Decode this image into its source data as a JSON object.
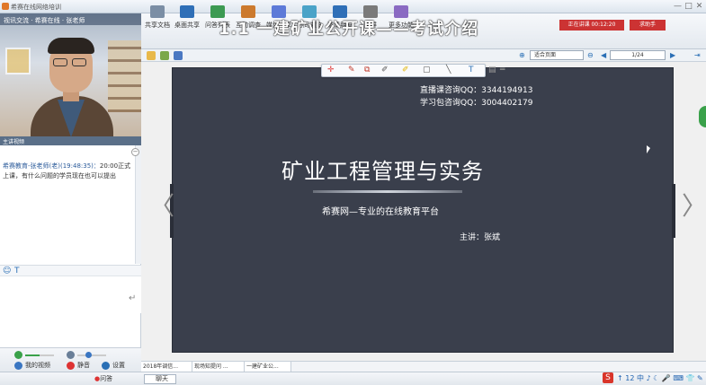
{
  "window": {
    "title": "希赛在线网络培训",
    "controls": [
      "—",
      "□",
      "✕"
    ]
  },
  "left_panel": {
    "video_caption": "视讯交流 · 希赛在线 · 张老师",
    "video_bar_label": "主讲视频",
    "chat": {
      "sender": "希赛教育-张老师(老)(19:48:35)：",
      "message": "20:00正式上课，有什么问题的学员现在也可以提出"
    },
    "chat_tools": [
      "☺",
      "T"
    ],
    "media": {
      "mic_label": "我的视频",
      "mute_label": "静音",
      "settings_label": "设置"
    }
  },
  "toolbar": {
    "items": [
      {
        "label": "共享文档",
        "color": "#7b8ea5"
      },
      {
        "label": "桌面共享",
        "color": "#2f6fb7"
      },
      {
        "label": "问答列表",
        "color": "#3c9a52"
      },
      {
        "label": "互动调查",
        "color": "#cc7a2e"
      },
      {
        "label": "媒体共享",
        "color": "#5d7ad8"
      },
      {
        "label": "协同浏览",
        "color": "#4aa3c8"
      },
      {
        "label": "邀请朋友",
        "color": "#2f6fb7"
      },
      {
        "label": "录屏",
        "color": "#7a7a7a"
      },
      {
        "label": "更多功能",
        "color": "#8a6ac2"
      }
    ],
    "course_title": "1.1 一建矿业公开课——考试介绍",
    "live_badge": "正在讲课 00:12:20",
    "exit_badge": "求助手"
  },
  "navbar": {
    "fit_mode": "适合页面",
    "page": "1/24"
  },
  "slide": {
    "contact1": "直播课咨询QQ：3344194913",
    "contact2": "学习包咨询QQ：3004402179",
    "title": "矿业工程管理与实务",
    "subtitle": "希赛网—专业的在线教育平台",
    "presenter": "主讲：张斌"
  },
  "annotation_tools": [
    {
      "glyph": "✛",
      "name": "pointer-icon",
      "color": "#d33"
    },
    {
      "glyph": "✎",
      "name": "eraser-icon",
      "color": "#c0392b"
    },
    {
      "glyph": "⧉",
      "name": "copy-icon",
      "color": "#c0392b"
    },
    {
      "glyph": "✐",
      "name": "pen-icon",
      "color": "#555"
    },
    {
      "glyph": "✐",
      "name": "highlighter-icon",
      "color": "#e2b400"
    },
    {
      "glyph": "▢",
      "name": "rectangle-icon",
      "color": "#555"
    },
    {
      "glyph": "╲",
      "name": "line-icon",
      "color": "#555"
    },
    {
      "glyph": "T",
      "name": "text-icon",
      "color": "#2a6fb5"
    },
    {
      "glyph": "▤",
      "name": "layout-icon",
      "color": "#999"
    },
    {
      "glyph": "═",
      "name": "menu-icon",
      "color": "#999"
    }
  ],
  "tabs": [
    "2018年调信...",
    "现场知提问 ...",
    "一建矿业公..."
  ],
  "statusbar": {
    "qa_label": "问答",
    "chat_label": "聊天",
    "tray": "↑ 12 中 ♪ ☾ 🎤 ⌨ 👕 ✎"
  }
}
